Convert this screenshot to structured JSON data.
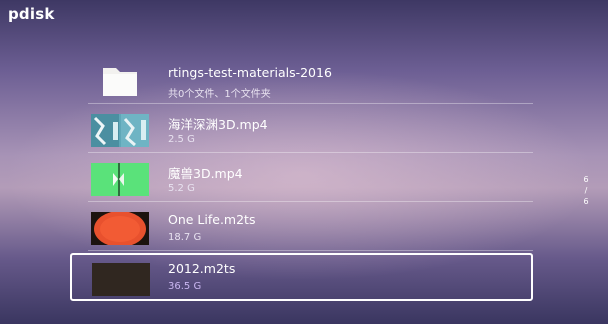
{
  "app": {
    "title": "pdisk"
  },
  "files": [
    {
      "name": "rtings-test-materials-2016",
      "detail": "共0个文件、1个文件夹",
      "type": "folder",
      "thumb_icon": "folder-icon"
    },
    {
      "name": "海洋深渊3D.mp4",
      "detail": "2.5 G",
      "type": "video",
      "thumb_icon": "video-thumbnail"
    },
    {
      "name": "魔兽3D.mp4",
      "detail": "5.2 G",
      "type": "video",
      "thumb_icon": "video-thumbnail"
    },
    {
      "name": "One Life.m2ts",
      "detail": "18.7 G",
      "type": "video",
      "thumb_icon": "video-thumbnail"
    },
    {
      "name": "2012.m2ts",
      "detail": "36.5 G",
      "type": "video",
      "thumb_icon": "video-thumbnail",
      "selected": true
    }
  ],
  "pager": {
    "current": "6",
    "separator": "/",
    "total": "6"
  },
  "colors": {
    "selection_border": "#ffffff",
    "selected_detail_text": "#c9b6f0",
    "text": "#ffffff"
  }
}
